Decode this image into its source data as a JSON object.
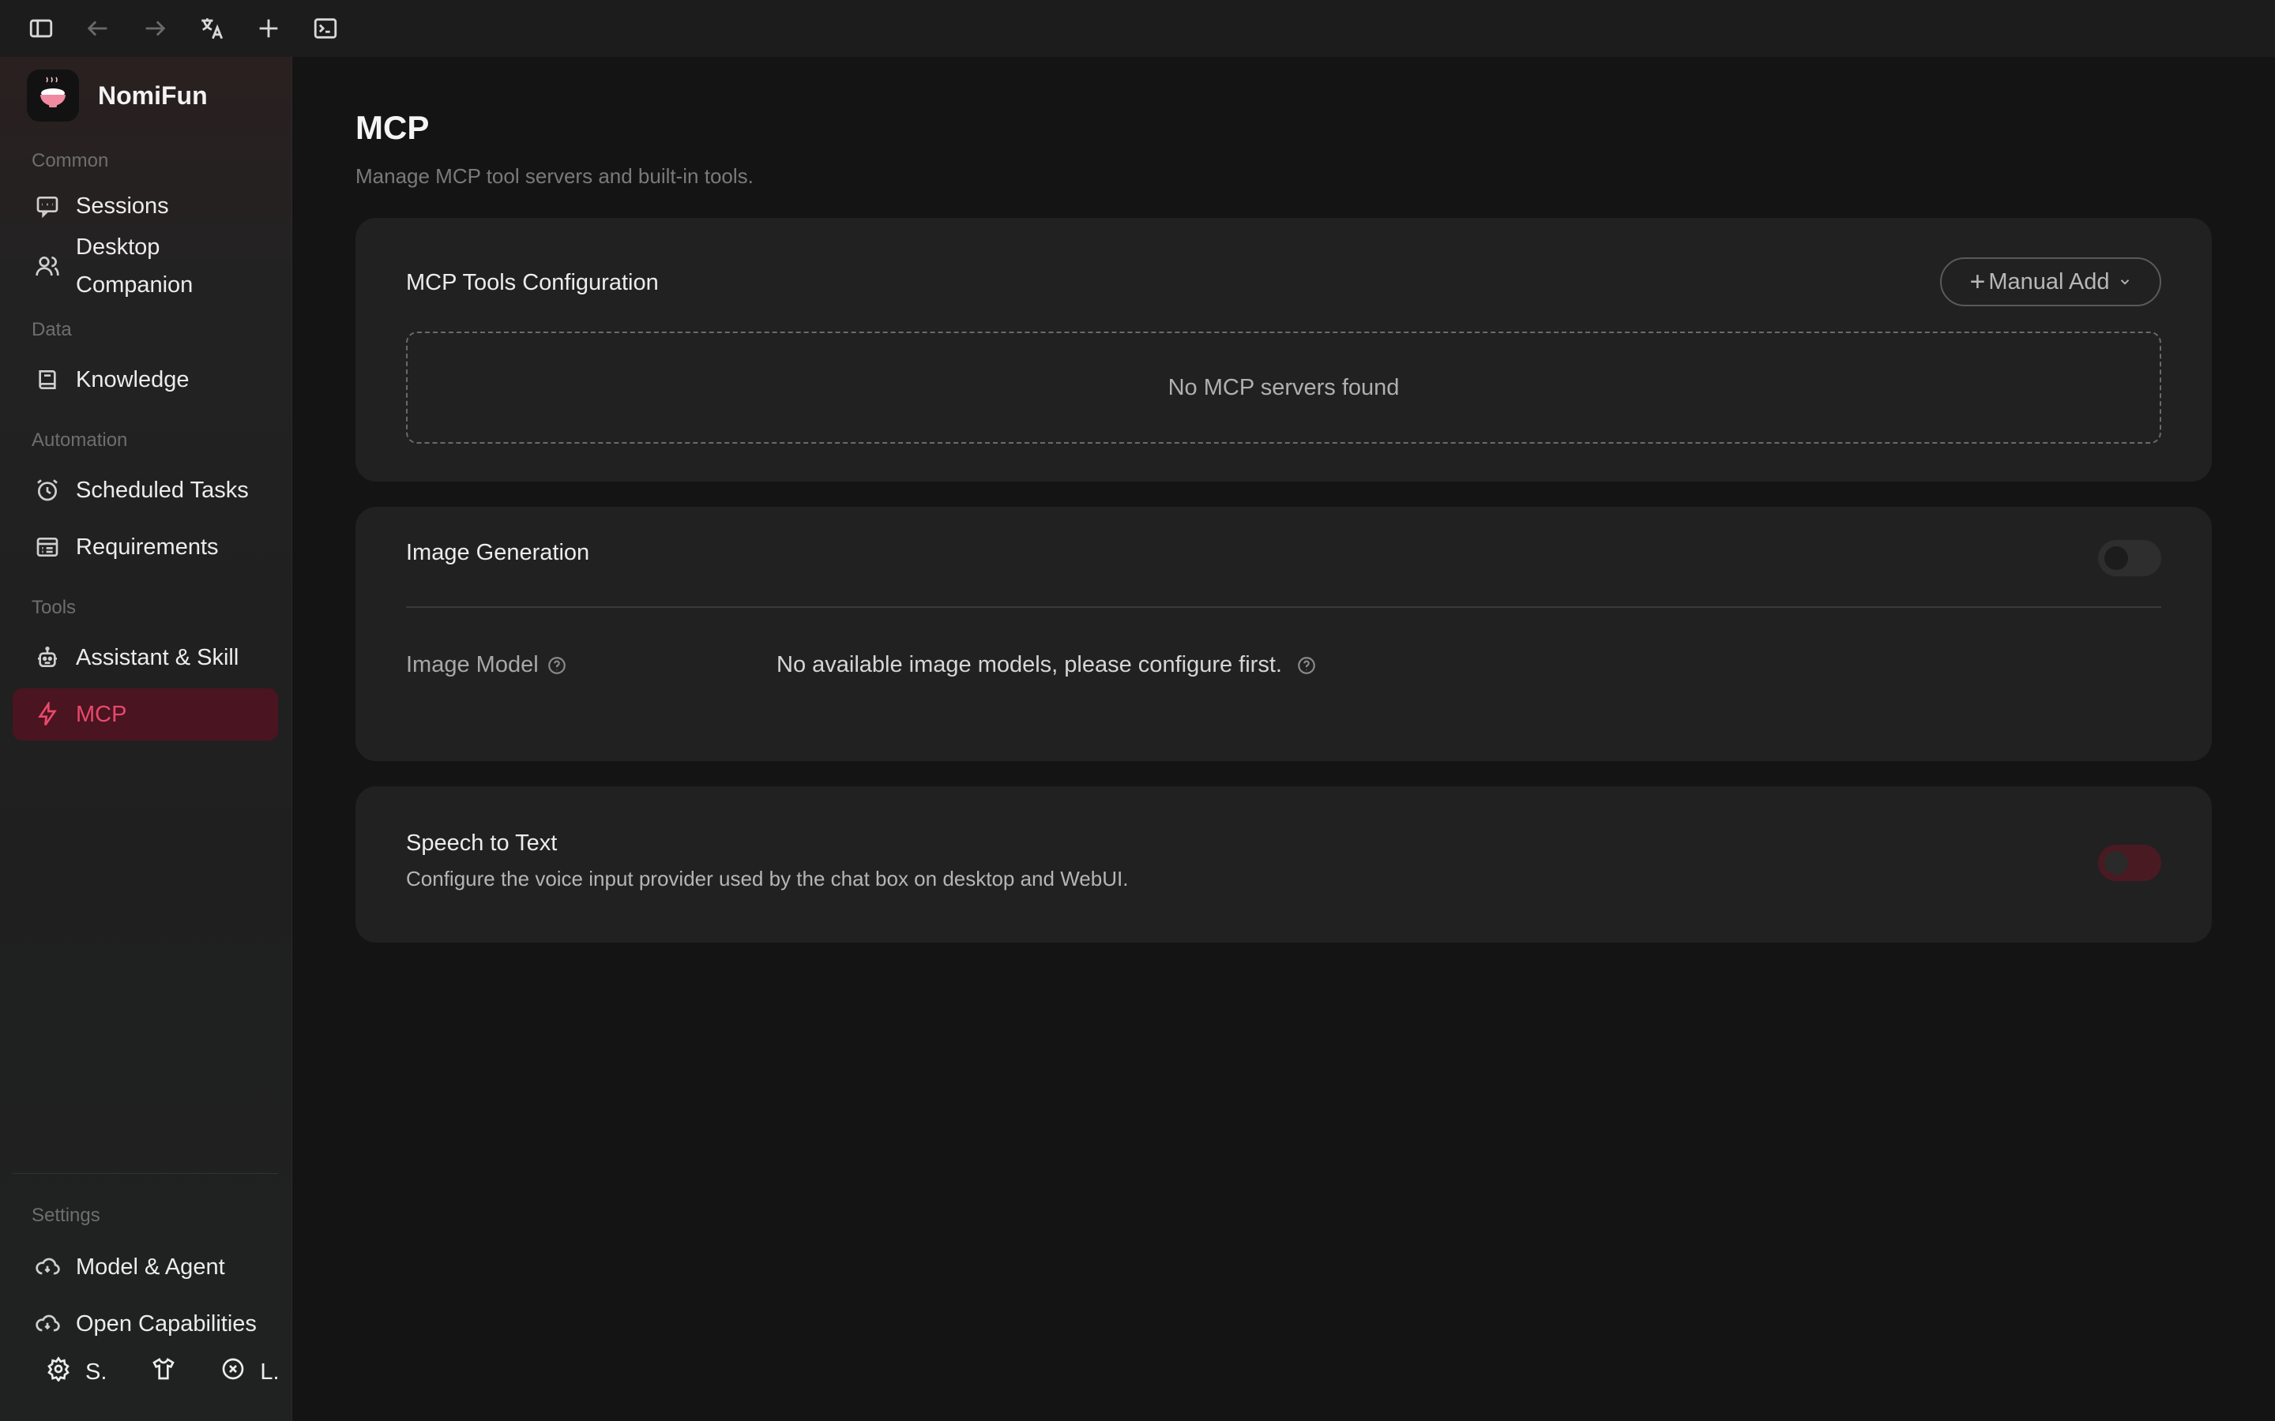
{
  "app": {
    "name": "NomiFun"
  },
  "toolbar": {
    "icons": [
      "sidebar-toggle-icon",
      "back-arrow-icon",
      "forward-arrow-icon",
      "translate-icon",
      "plus-icon",
      "terminal-icon"
    ]
  },
  "sidebar": {
    "sections": {
      "common": "Common",
      "data": "Data",
      "automation": "Automation",
      "tools": "Tools",
      "settings": "Settings"
    },
    "items": {
      "sessions": "Sessions",
      "desktop_companion_line1": "Desktop",
      "desktop_companion_line2": "Companion",
      "knowledge": "Knowledge",
      "scheduled_tasks": "Scheduled Tasks",
      "requirements": "Requirements",
      "assistant_skill": "Assistant & Skill",
      "mcp": "MCP",
      "model_agent": "Model & Agent",
      "open_capabilities": "Open Capabilities"
    },
    "bottom": {
      "settings_short": "S.",
      "language_short": "L."
    },
    "accent_color": "#e8496c"
  },
  "main": {
    "title": "MCP",
    "subtitle": "Manage MCP tool servers and built-in tools.",
    "mcp_tools": {
      "title": "MCP Tools Configuration",
      "manual_add_plus": "+",
      "manual_add_label": "Manual Add",
      "empty_text": "No MCP servers found"
    },
    "image_generation": {
      "title": "Image Generation",
      "enabled": false,
      "model_label": "Image Model",
      "model_value": "No available image models, please configure first."
    },
    "speech_to_text": {
      "title": "Speech to Text",
      "description": "Configure the voice input provider used by the chat box on desktop and WebUI.",
      "enabled": false
    }
  }
}
